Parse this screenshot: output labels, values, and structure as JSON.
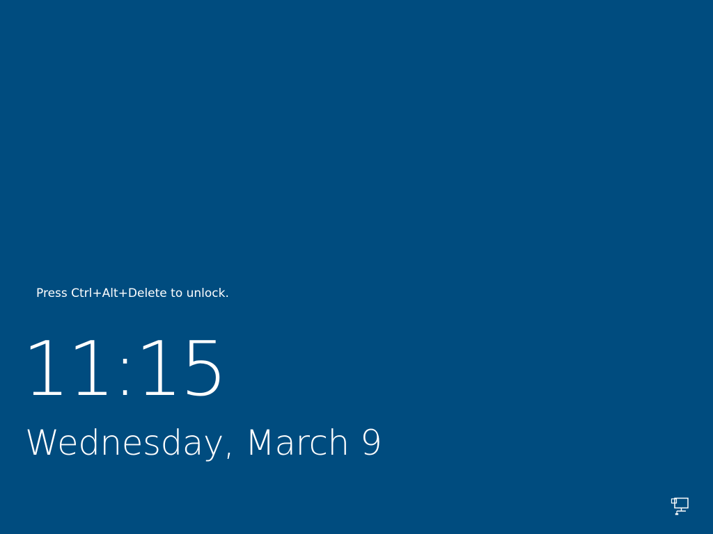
{
  "lock_screen": {
    "unlock_hint": "Press Ctrl+Alt+Delete to unlock.",
    "time": "11:15",
    "date": "Wednesday, March 9"
  },
  "status": {
    "network_icon": "network-icon"
  },
  "colors": {
    "background": "#004c7f",
    "foreground": "#ffffff"
  }
}
